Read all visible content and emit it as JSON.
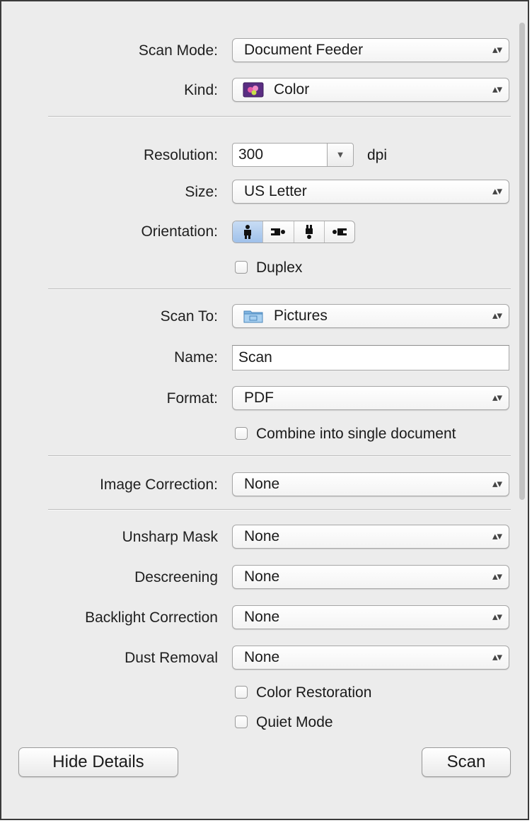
{
  "scan_mode": {
    "label": "Scan Mode:",
    "value": "Document Feeder"
  },
  "kind": {
    "label": "Kind:",
    "value": "Color"
  },
  "resolution": {
    "label": "Resolution:",
    "value": "300",
    "unit": "dpi"
  },
  "size": {
    "label": "Size:",
    "value": "US Letter"
  },
  "orientation": {
    "label": "Orientation:",
    "selected_index": 0,
    "options": [
      "portrait-upright-icon",
      "landscape-right-icon",
      "portrait-inverted-icon",
      "landscape-left-icon"
    ]
  },
  "duplex": {
    "label": "Duplex",
    "checked": false
  },
  "scan_to": {
    "label": "Scan To:",
    "value": "Pictures"
  },
  "name": {
    "label": "Name:",
    "value": "Scan"
  },
  "format": {
    "label": "Format:",
    "value": "PDF"
  },
  "combine": {
    "label": "Combine into single document",
    "checked": false
  },
  "image_correction": {
    "label": "Image Correction:",
    "value": "None"
  },
  "unsharp_mask": {
    "label": "Unsharp Mask",
    "value": "None"
  },
  "descreening": {
    "label": "Descreening",
    "value": "None"
  },
  "backlight_correction": {
    "label": "Backlight Correction",
    "value": "None"
  },
  "dust_removal": {
    "label": "Dust Removal",
    "value": "None"
  },
  "color_restoration": {
    "label": "Color Restoration",
    "checked": false
  },
  "quiet_mode": {
    "label": "Quiet Mode",
    "checked": false
  },
  "buttons": {
    "hide_details": "Hide Details",
    "scan": "Scan"
  },
  "colors": {
    "panel_bg": "#ececec",
    "selected_segment": "#a9c8ee",
    "border": "#a6a6a6"
  }
}
